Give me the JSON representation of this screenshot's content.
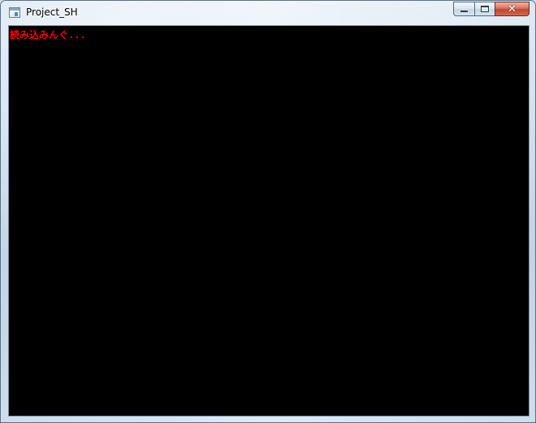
{
  "window": {
    "title": "Project_SH",
    "controls": {
      "minimize_icon": "minimize-icon",
      "maximize_icon": "maximize-icon",
      "close_icon": "close-icon",
      "close_glyph": "✕"
    }
  },
  "content": {
    "status_text": "読み込みんぐ...",
    "background_color": "#000000",
    "status_color": "#ff0000"
  }
}
